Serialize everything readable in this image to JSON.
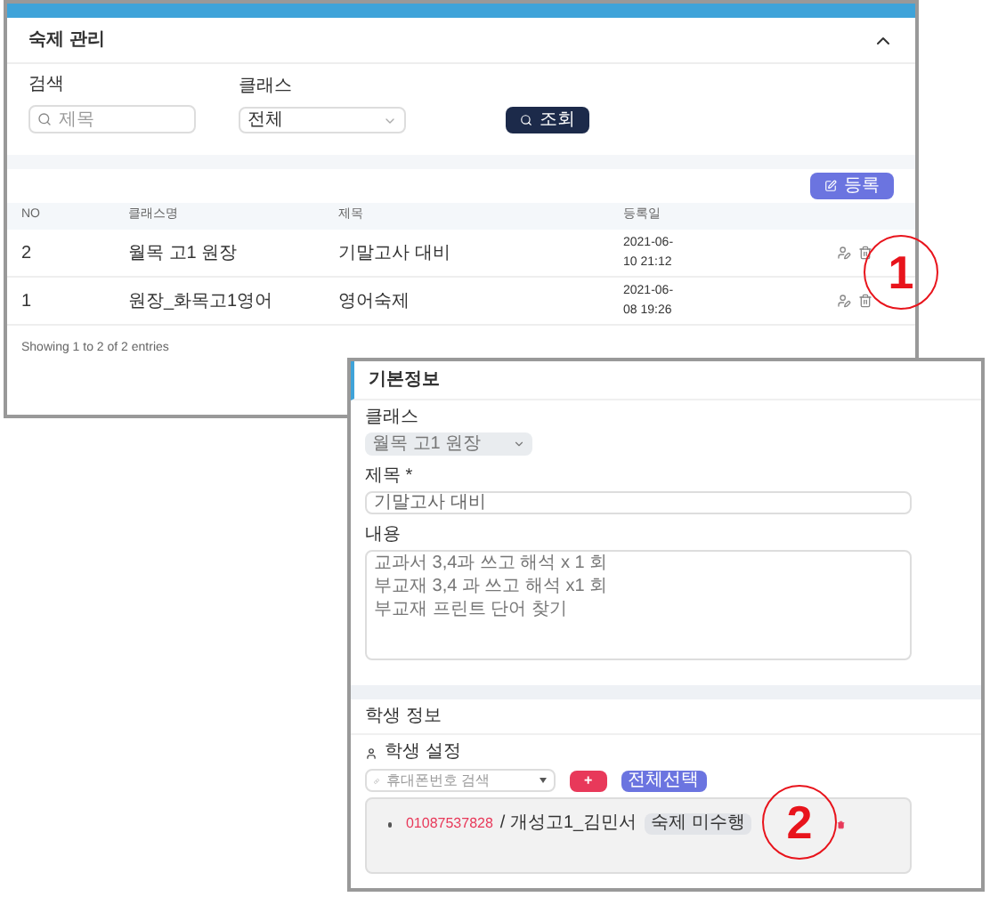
{
  "panel": {
    "title": "숙제 관리",
    "search": {
      "label": "검색",
      "placeholder": "제목"
    },
    "class_filter": {
      "label": "클래스",
      "value": "전체"
    },
    "search_button": "조회",
    "register_button": "등록",
    "table": {
      "columns": [
        "NO",
        "클래스명",
        "제목",
        "등록일"
      ],
      "rows": [
        {
          "no": "2",
          "class_name": "월목 고1 원장",
          "title": "기말고사 대비",
          "date_lines": [
            "2021-06-",
            "10 21:12"
          ]
        },
        {
          "no": "1",
          "class_name": "원장_화목고1영어",
          "title": "영어숙제",
          "date_lines": [
            "2021-06-",
            "08 19:26"
          ]
        }
      ]
    },
    "footer": "Showing 1 to 2 of 2 entries"
  },
  "callouts": [
    "1",
    "2"
  ],
  "detail": {
    "basic_title": "기본정보",
    "class_field": {
      "label": "클래스",
      "value": "월목 고1 원장",
      "disabled": true
    },
    "title_field": {
      "label": "제목 *",
      "value": "기말고사 대비"
    },
    "content_field": {
      "label": "내용",
      "lines": [
        "교과서 3,4과 쓰고 해석 x 1 회",
        "부교재 3,4 과 쓰고 해석 x1 회",
        "부교재 프린트 단어 찾기"
      ]
    },
    "student_title": "학생 정보",
    "student_setting": "학생 설정",
    "phone_search": {
      "placeholder": "휴대폰번호 검색"
    },
    "add_button": "+",
    "select_all_button": "전체선택",
    "students": [
      {
        "phone": "01087537828",
        "name": "/ 개성고1_김민서",
        "status": "숙제 미수행"
      }
    ]
  }
}
